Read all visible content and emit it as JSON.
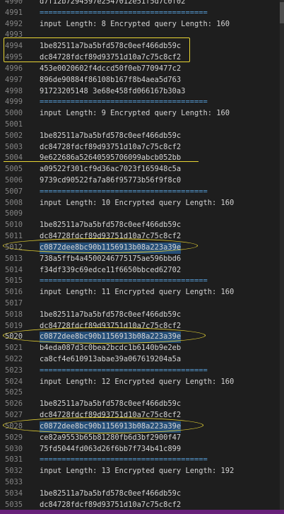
{
  "editor": {
    "lines": [
      {
        "n": "4990",
        "text": "d7f12b7294597e2547012e51f5d7c0f02",
        "sep": false
      },
      {
        "n": "4991",
        "text": "======================================",
        "sep": true
      },
      {
        "n": "4992",
        "text": "input Length: 8 Encrypted query Length: 160",
        "sep": false
      },
      {
        "n": "4993",
        "text": "",
        "sep": false
      },
      {
        "n": "4994",
        "text": "1be82511a7ba5bfd578c0eef466db59c",
        "sep": false
      },
      {
        "n": "4995",
        "text": "dc84728fdcf89d93751d10a7c75c8cf2",
        "sep": false
      },
      {
        "n": "4996",
        "text": "453e0020602f4dccd50f0eb7709477c2",
        "sep": false
      },
      {
        "n": "4997",
        "text": "896de90884f86108b167f8b4aea5d763",
        "sep": false
      },
      {
        "n": "4998",
        "text": "91723205148 3e68e458fd066167b30a3",
        "sep": false
      },
      {
        "n": "4999",
        "text": "======================================",
        "sep": true
      },
      {
        "n": "5000",
        "text": "input Length: 9 Encrypted query Length: 160",
        "sep": false
      },
      {
        "n": "5001",
        "text": "",
        "sep": false
      },
      {
        "n": "5002",
        "text": "1be82511a7ba5bfd578c0eef466db59c",
        "sep": false
      },
      {
        "n": "5003",
        "text": "dc84728fdcf89d93751d10a7c75c8cf2",
        "sep": false
      },
      {
        "n": "5004",
        "text": "9e622686a52640595706099abcb052bb",
        "sep": false
      },
      {
        "n": "5005",
        "text": "a09522f301cf9d36ac7023f165948c5a",
        "sep": false
      },
      {
        "n": "5006",
        "text": "9739cd90522fa7a86f95773b56f9f8c0",
        "sep": false
      },
      {
        "n": "5007",
        "text": "======================================",
        "sep": true
      },
      {
        "n": "5008",
        "text": "input Length: 10 Encrypted query Length: 160",
        "sep": false
      },
      {
        "n": "5009",
        "text": "",
        "sep": false
      },
      {
        "n": "5010",
        "text": "1be82511a7ba5bfd578c0eef466db59c",
        "sep": false
      },
      {
        "n": "5011",
        "text": "dc84728fdcf89d93751d10a7c75c8cf2",
        "sep": false
      },
      {
        "n": "5012",
        "text": "c0872dee8bc90b1156913b08a223a39e",
        "sep": false
      },
      {
        "n": "5013",
        "text": "738a5ffb4a4500246775175ae596bbd6",
        "sep": false
      },
      {
        "n": "5014",
        "text": "f34df339c69edce11f6650bbced62702",
        "sep": false
      },
      {
        "n": "5015",
        "text": "======================================",
        "sep": true
      },
      {
        "n": "5016",
        "text": "input Length: 11 Encrypted query Length: 160",
        "sep": false
      },
      {
        "n": "5017",
        "text": "",
        "sep": false
      },
      {
        "n": "5018",
        "text": "1be82511a7ba5bfd578c0eef466db59c",
        "sep": false
      },
      {
        "n": "5019",
        "text": "dc84728fdcf89d93751d10a7c75c8cf2",
        "sep": false
      },
      {
        "n": "5020",
        "text": "c0872dee8bc90b1156913b08a223a39e",
        "sep": false,
        "active": true
      },
      {
        "n": "5021",
        "text": "b4eda087d3c0bea2bcdc1b6140b9e2eb",
        "sep": false
      },
      {
        "n": "5022",
        "text": "ca8cf4e610913abae39a067619204a5a",
        "sep": false
      },
      {
        "n": "5023",
        "text": "======================================",
        "sep": true
      },
      {
        "n": "5024",
        "text": "input Length: 12 Encrypted query Length: 160",
        "sep": false
      },
      {
        "n": "5025",
        "text": "",
        "sep": false
      },
      {
        "n": "5026",
        "text": "1be82511a7ba5bfd578c0eef466db59c",
        "sep": false
      },
      {
        "n": "5027",
        "text": "dc84728fdcf89d93751d10a7c75c8cf2",
        "sep": false
      },
      {
        "n": "5028",
        "text": "c0872dee8bc90b1156913b08a223a39e",
        "sep": false
      },
      {
        "n": "5029",
        "text": "ce82a9553b65b81280fb6d3bf2900f47",
        "sep": false
      },
      {
        "n": "5030",
        "text": "75fd5044fd063d26f6bb7f734b41c899",
        "sep": false
      },
      {
        "n": "5031",
        "text": "======================================",
        "sep": true
      },
      {
        "n": "5032",
        "text": "input Length: 13 Encrypted query Length: 192",
        "sep": false
      },
      {
        "n": "5033",
        "text": "",
        "sep": false
      },
      {
        "n": "5034",
        "text": "1be82511a7ba5bfd578c0eef466db59c",
        "sep": false
      },
      {
        "n": "5035",
        "text": "dc84728fdcf89d93751d10a7c75c8cf2",
        "sep": false
      }
    ],
    "selection_highlights": [
      "c0872dee8bc90b1156913b08a223a39e"
    ],
    "annotation_color": "#e8d534",
    "background_color": "#1e1e1e",
    "statusbar_color": "#68217a"
  }
}
